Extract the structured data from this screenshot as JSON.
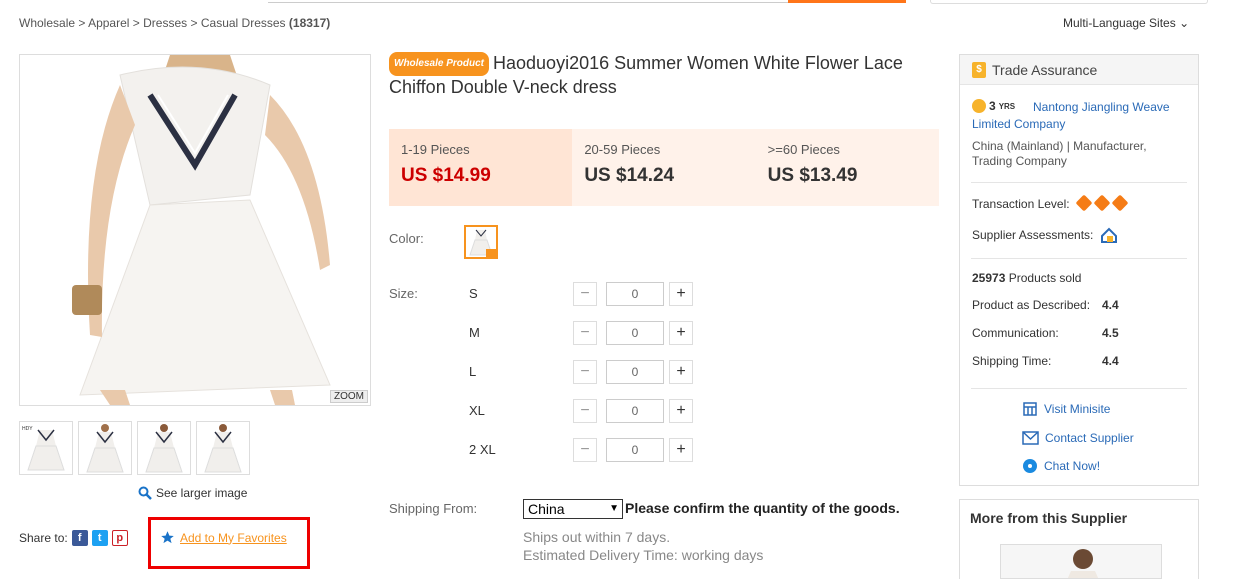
{
  "breadcrumb": {
    "items": [
      "Wholesale",
      "Apparel",
      "Dresses",
      "Casual Dresses"
    ],
    "separator": ">",
    "count": "(18317)"
  },
  "header": {
    "multi_language": "Multi-Language Sites"
  },
  "gallery": {
    "zoom_label": "ZOOM",
    "see_larger": "See larger image",
    "thumb_badge": "HDY"
  },
  "share": {
    "label": "Share to:",
    "add_favorites": "Add to My Favorites"
  },
  "product": {
    "badge": "Wholesale Product",
    "title": "Haoduoyi2016 Summer Women White Flower Lace Chiffon Double V-neck dress",
    "tiers": [
      {
        "qty": "1-19 Pieces",
        "price": "US $14.99"
      },
      {
        "qty": "20-59 Pieces",
        "price": "US $14.24"
      },
      {
        "qty": ">=60 Pieces",
        "price": "US $13.49"
      }
    ],
    "color_label": "Color:",
    "size_label": "Size:",
    "sizes": [
      {
        "name": "S",
        "qty": "0"
      },
      {
        "name": "M",
        "qty": "0"
      },
      {
        "name": "L",
        "qty": "0"
      },
      {
        "name": "XL",
        "qty": "0"
      },
      {
        "name": "2 XL",
        "qty": "0"
      }
    ],
    "shipping_from_label": "Shipping From:",
    "shipping_from_value": "China",
    "confirm_msg": "Please confirm the quantity of the goods.",
    "ships_out": "Ships out within 7 days.",
    "delivery": "Estimated Delivery Time: working days"
  },
  "supplier": {
    "trade_assurance": "Trade Assurance",
    "years_num": "3",
    "years_unit": "YRS",
    "name": "Nantong Jiangling Weave Limited Company",
    "location": "China (Mainland) | Manufacturer, Trading Company",
    "transaction_level": "Transaction Level:",
    "supplier_assessments": "Supplier Assessments:",
    "products_sold_num": "25973",
    "products_sold_label": "Products sold",
    "ratings": [
      {
        "label": "Product as Described:",
        "value": "4.4"
      },
      {
        "label": "Communication:",
        "value": "4.5"
      },
      {
        "label": "Shipping Time:",
        "value": "4.4"
      }
    ],
    "visit_minisite": "Visit Minisite",
    "contact_supplier": "Contact Supplier",
    "chat_now": "Chat Now!"
  },
  "more": {
    "title": "More from this Supplier"
  },
  "colors": {
    "accent": "#f7931e",
    "price_red": "#cc0000",
    "link": "#2a6ab7",
    "highlight": "#ee0000"
  }
}
